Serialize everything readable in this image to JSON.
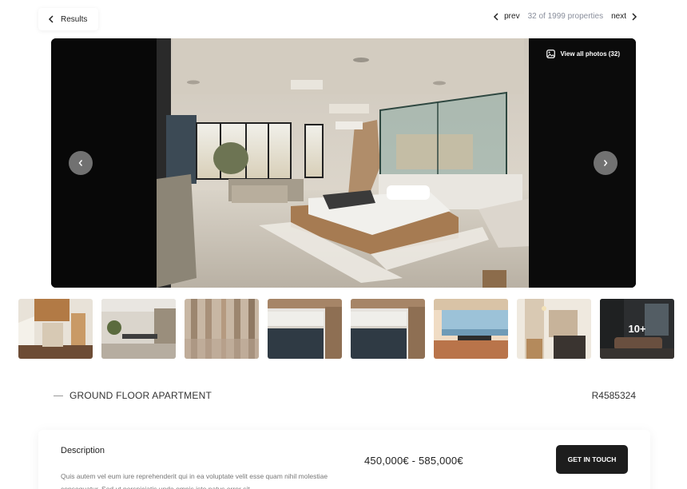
{
  "nav": {
    "back_label": "Results",
    "prev_label": "prev",
    "next_label": "next",
    "position_text": "32 of 1999 properties"
  },
  "gallery": {
    "view_all_label": "View all photos (32)",
    "more_label": "10+",
    "thumbnails": [
      "staircase",
      "dining-plant",
      "curtains",
      "kitchen",
      "kitchen",
      "sea-view-dining",
      "hallway-bar",
      "living-room"
    ]
  },
  "listing": {
    "type": "GROUND FLOOR APARTMENT",
    "reference": "R4585324",
    "description_title": "Description",
    "description_text": "Quis autem vel eum iure reprehenderit qui in ea voluptate velit esse quam nihil molestiae consequatur. Sed ut perspiciatis unde omnis iste natus error sit",
    "price": "450,000€ - 585,000€",
    "cta_label": "GET IN TOUCH"
  },
  "icons": {
    "back": "chevron-left-icon",
    "prev": "chevron-left-icon",
    "next": "chevron-right-icon",
    "gallery": "image-icon"
  }
}
